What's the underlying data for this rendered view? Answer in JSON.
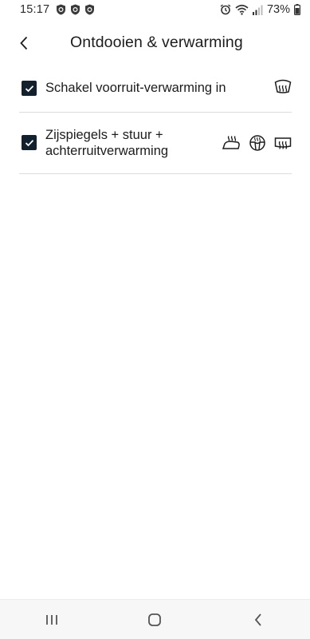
{
  "status_bar": {
    "time": "15:17",
    "battery": "73%",
    "icons": [
      "shield-icon",
      "shield-icon",
      "shield-icon",
      "alarm-icon",
      "wifi-icon",
      "signal-icon"
    ]
  },
  "header": {
    "title": "Ontdooien & verwarming",
    "back_icon": "chevron-left-icon"
  },
  "options": [
    {
      "label": "Schakel voorruit-verwarming in",
      "checked": true,
      "icons": [
        "windshield-heat-icon"
      ]
    },
    {
      "label": "Zijspiegels + stuur + achterruitverwarming",
      "checked": true,
      "icons": [
        "mirror-heat-icon",
        "steering-wheel-heat-icon",
        "rear-window-heat-icon"
      ]
    }
  ],
  "nav_bar": {
    "items": [
      "recent-apps-icon",
      "home-icon",
      "back-icon"
    ]
  },
  "colors": {
    "checkbox": "#13202e",
    "divider": "#dcdcdc",
    "navbar_bg": "#f7f7f7"
  }
}
